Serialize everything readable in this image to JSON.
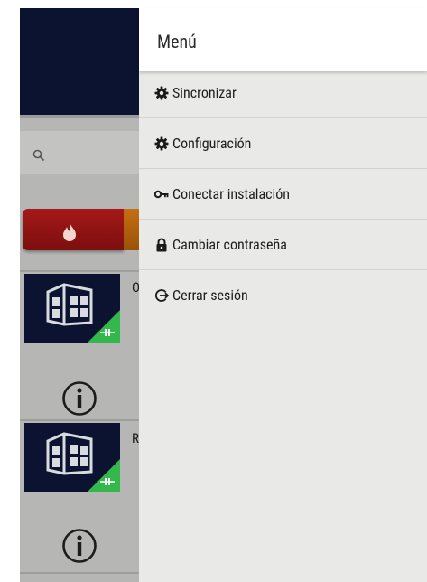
{
  "menu": {
    "title": "Menú",
    "items": [
      {
        "label": "Sincronizar",
        "icon": "gear-icon"
      },
      {
        "label": "Configuración",
        "icon": "gear-icon"
      },
      {
        "label": "Conectar instalación",
        "icon": "key-icon"
      },
      {
        "label": "Cambiar contraseña",
        "icon": "lock-icon"
      },
      {
        "label": "Cerrar sesión",
        "icon": "logout-icon"
      }
    ]
  },
  "background": {
    "installations": [
      {
        "letter": "O"
      },
      {
        "letter": "R"
      }
    ]
  },
  "colors": {
    "header_navy": "#0c1330",
    "fire_red": "#a41818",
    "status_green": "#34b84c",
    "drawer_bg": "#e9e9e7"
  }
}
